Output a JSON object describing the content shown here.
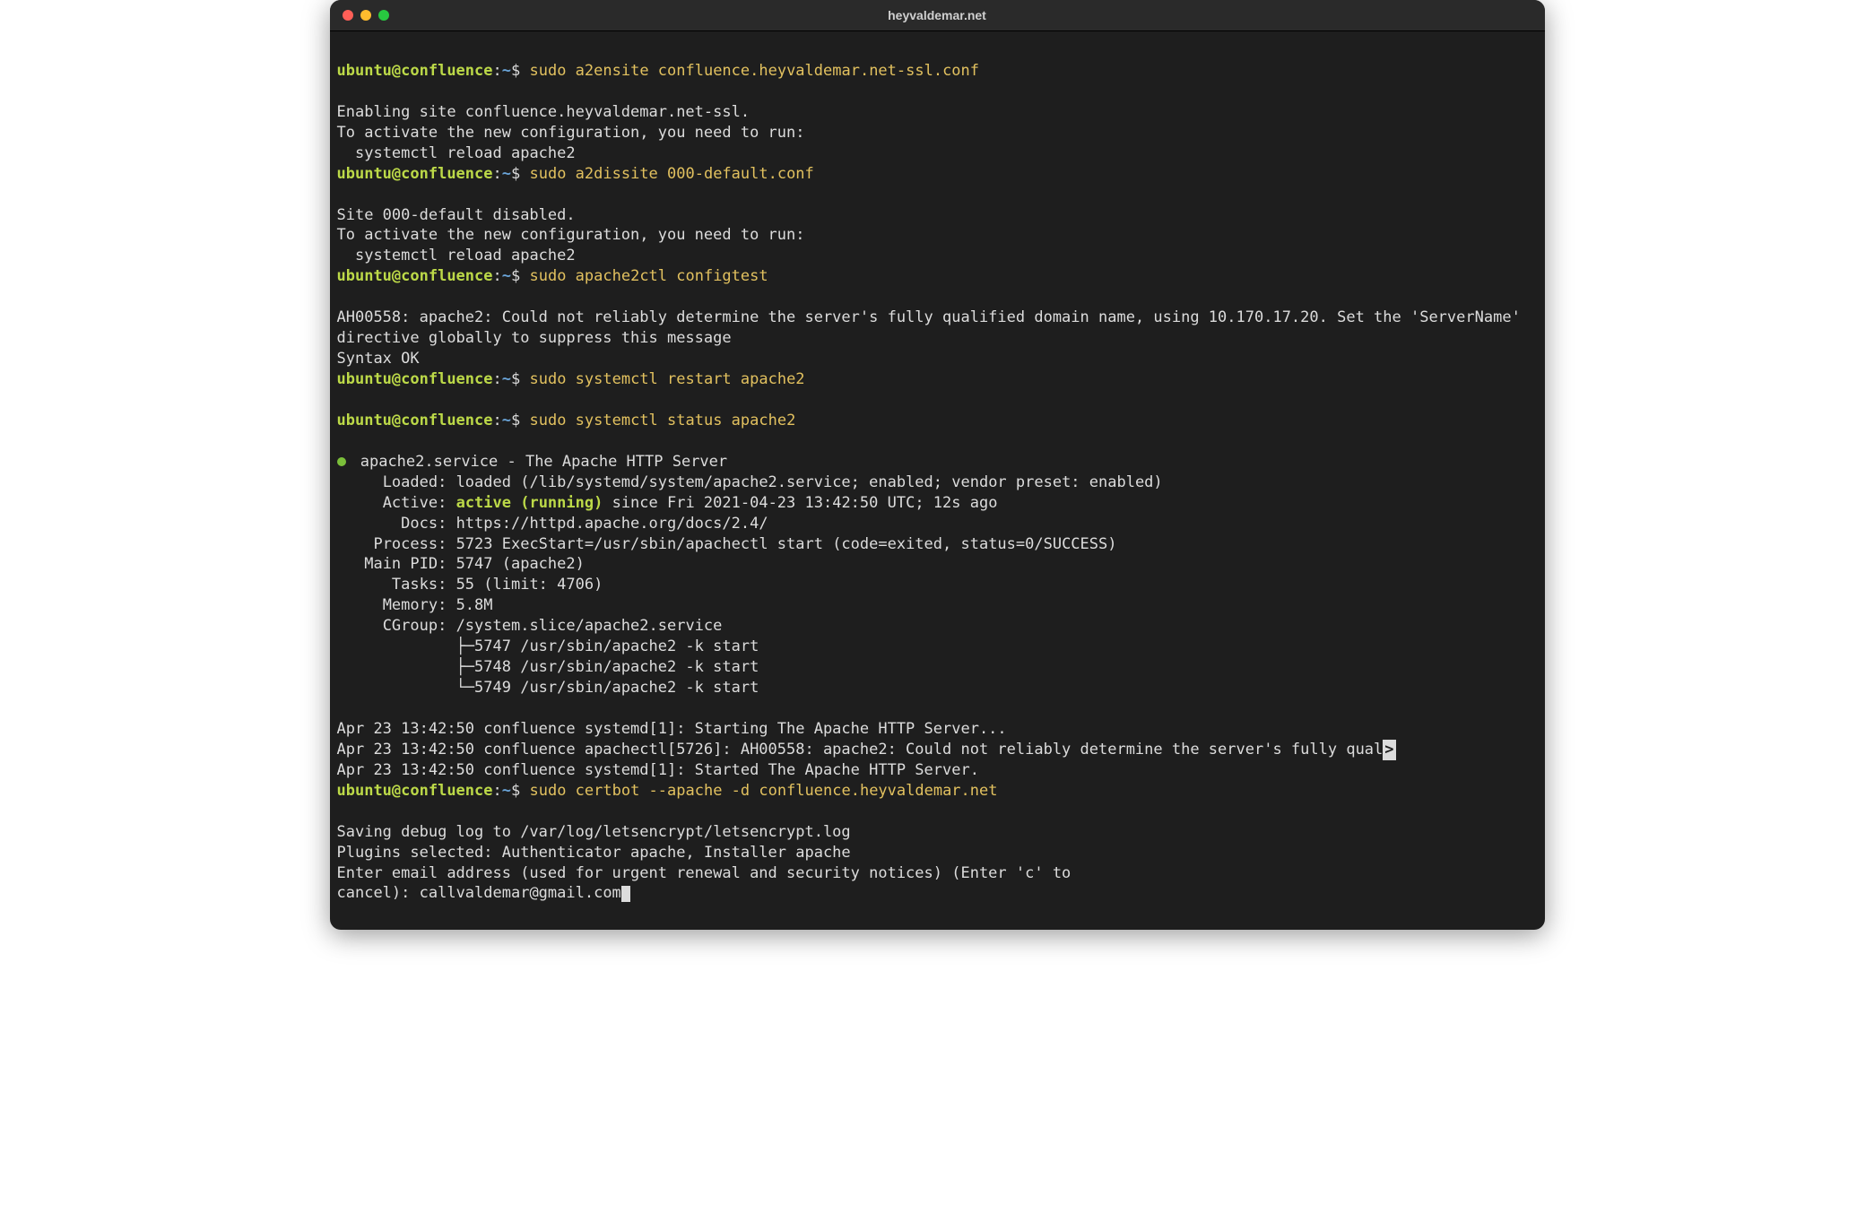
{
  "window": {
    "title": "heyvaldemar.net"
  },
  "prompt": {
    "user": "ubuntu@confluence",
    "path": "~",
    "symbol": "$"
  },
  "cmd1": "sudo a2ensite confluence.heyvaldemar.net-ssl.conf",
  "out1a": "Enabling site confluence.heyvaldemar.net-ssl.",
  "out1b": "To activate the new configuration, you need to run:",
  "out1c": "  systemctl reload apache2",
  "cmd2": "sudo a2dissite 000-default.conf",
  "out2a": "Site 000-default disabled.",
  "out2b": "To activate the new configuration, you need to run:",
  "out2c": "  systemctl reload apache2",
  "cmd3": "sudo apache2ctl configtest",
  "out3a": "AH00558: apache2: Could not reliably determine the server's fully qualified domain name, using 10.170.17.20. Set the 'ServerName' directive globally to suppress this message",
  "out3b": "Syntax OK",
  "cmd4": "sudo systemctl restart apache2",
  "cmd5": "sudo systemctl status apache2",
  "status": {
    "head": " apache2.service - The Apache HTTP Server",
    "loaded": "     Loaded: loaded (/lib/systemd/system/apache2.service; enabled; vendor preset: enabled)",
    "active_label": "     Active: ",
    "active_value": "active (running)",
    "active_rest": " since Fri 2021-04-23 13:42:50 UTC; 12s ago",
    "docs": "       Docs: https://httpd.apache.org/docs/2.4/",
    "process": "    Process: 5723 ExecStart=/usr/sbin/apachectl start (code=exited, status=0/SUCCESS)",
    "mainpid": "   Main PID: 5747 (apache2)",
    "tasks": "      Tasks: 55 (limit: 4706)",
    "memory": "     Memory: 5.8M",
    "cgroup": "     CGroup: /system.slice/apache2.service",
    "cg1": "             ├─5747 /usr/sbin/apache2 -k start",
    "cg2": "             ├─5748 /usr/sbin/apache2 -k start",
    "cg3": "             └─5749 /usr/sbin/apache2 -k start"
  },
  "log1": "Apr 23 13:42:50 confluence systemd[1]: Starting The Apache HTTP Server...",
  "log2": "Apr 23 13:42:50 confluence apachectl[5726]: AH00558: apache2: Could not reliably determine the server's fully qual",
  "log2_tail": ">",
  "log3": "Apr 23 13:42:50 confluence systemd[1]: Started The Apache HTTP Server.",
  "cmd6": "sudo certbot --apache -d confluence.heyvaldemar.net",
  "out6a": "Saving debug log to /var/log/letsencrypt/letsencrypt.log",
  "out6b": "Plugins selected: Authenticator apache, Installer apache",
  "out6c": "Enter email address (used for urgent renewal and security notices) (Enter 'c' to",
  "out6d": "cancel): ",
  "input6": "callvaldemar@gmail.com"
}
